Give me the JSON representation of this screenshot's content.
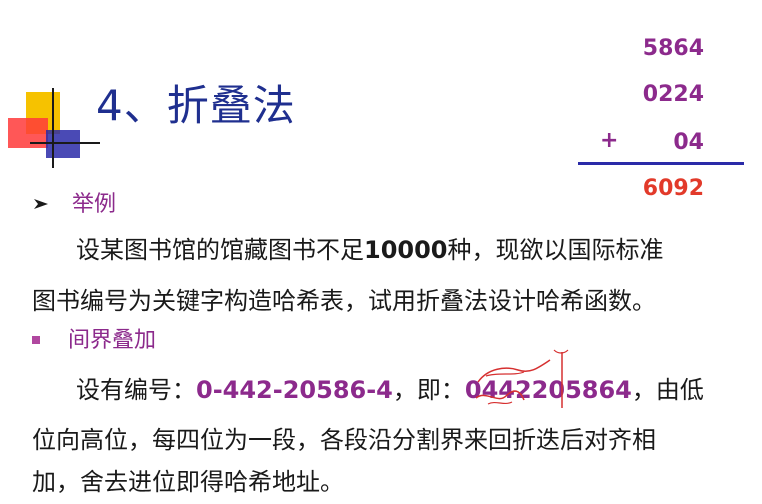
{
  "title": "4、折叠法",
  "calculation": {
    "addends": [
      "5864",
      "0224",
      "04"
    ],
    "operator": "+",
    "sum": "6092"
  },
  "bullet1": {
    "icon": "arrow-bullet-icon",
    "label": "举例",
    "line1_pre": "设某图书馆的馆藏图书不足",
    "line1_bold": "10000",
    "line1_post": "种，现欲以国际标准",
    "line2": "图书编号为关键字构造哈希表，试用折叠法设计哈希函数。"
  },
  "bullet2": {
    "icon": "square-bullet-icon",
    "label": "间界叠加",
    "line1_pre": "设有编号：",
    "isbn": "0-442-20586-4",
    "line1_mid": "，即：",
    "isbn_digits": "0442205864",
    "line1_post": "，由低",
    "line2": "位向高位，每四位为一段，各段沿分割界来回折迭后对齐相",
    "line3": "加，舍去进位即得哈希地址。"
  },
  "colors": {
    "title": "#1f2f8f",
    "purple": "#8c2a8c",
    "sum_red": "#e23a2a",
    "rule_blue": "#2a2aa8"
  }
}
